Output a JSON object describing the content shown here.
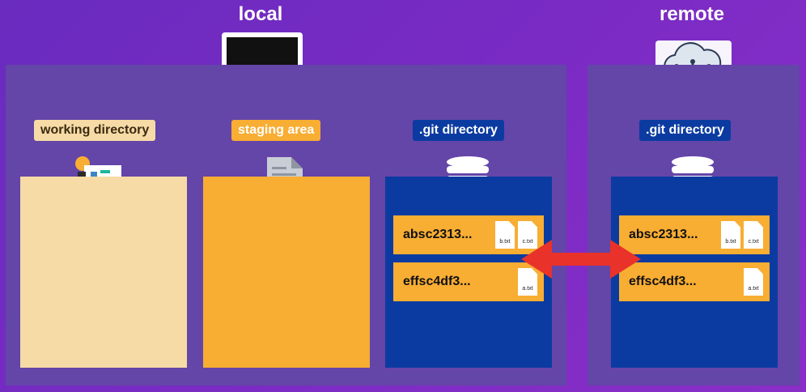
{
  "headings": {
    "local": "local",
    "remote": "remote"
  },
  "local": {
    "columns": [
      {
        "label": "working directory",
        "icon": "workspace-icon"
      },
      {
        "label": "staging area",
        "icon": "document-icon"
      },
      {
        "label": ".git directory",
        "icon": "database-icon",
        "commits": [
          {
            "hash": "absc2313...",
            "files": [
              "b.txt",
              "c.txt"
            ]
          },
          {
            "hash": "effsc4df3...",
            "files": [
              "a.txt"
            ]
          }
        ]
      }
    ]
  },
  "remote": {
    "label": ".git directory",
    "icon": "database-icon",
    "commits": [
      {
        "hash": "absc2313...",
        "files": [
          "b.txt",
          "c.txt"
        ]
      },
      {
        "hash": "effsc4df3...",
        "files": [
          "a.txt"
        ]
      }
    ]
  },
  "colors": {
    "background": "#7229c2",
    "panel": "#6445a8",
    "working": "#f7dba6",
    "staging": "#f8ad33",
    "git": "#0b3ba1",
    "commit": "#f8ad33",
    "arrow": "#e8322a"
  },
  "icons": {
    "laptop": "laptop-icon",
    "cloud": "cloud-network-icon",
    "arrow": "sync-arrow-icon"
  }
}
